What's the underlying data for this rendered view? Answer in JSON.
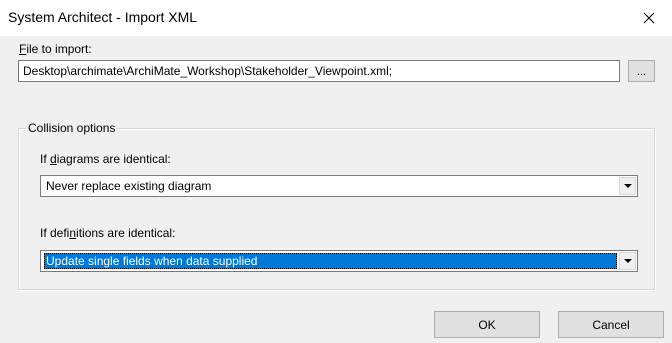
{
  "window": {
    "title": "System Architect - Import XML",
    "close_icon": "close-icon"
  },
  "file": {
    "label_mnemonic": "F",
    "label_rest": "ile to import:",
    "path": "Desktop\\archimate\\ArchiMate_Workshop\\Stakeholder_Viewpoint.xml;",
    "browse_label": "..."
  },
  "collision": {
    "legend": "Collision options",
    "diagrams": {
      "label_pre": "If ",
      "label_mnemonic": "d",
      "label_post": "iagrams are identical:",
      "selected": "Never replace existing diagram"
    },
    "definitions": {
      "label_pre": "If defi",
      "label_mnemonic": "n",
      "label_post": "itions are identical:",
      "selected": "Update single fields when data supplied"
    }
  },
  "buttons": {
    "ok": "OK",
    "cancel": "Cancel"
  },
  "colors": {
    "selection": "#0078d7",
    "dialog_bg": "#f0f0f0"
  }
}
